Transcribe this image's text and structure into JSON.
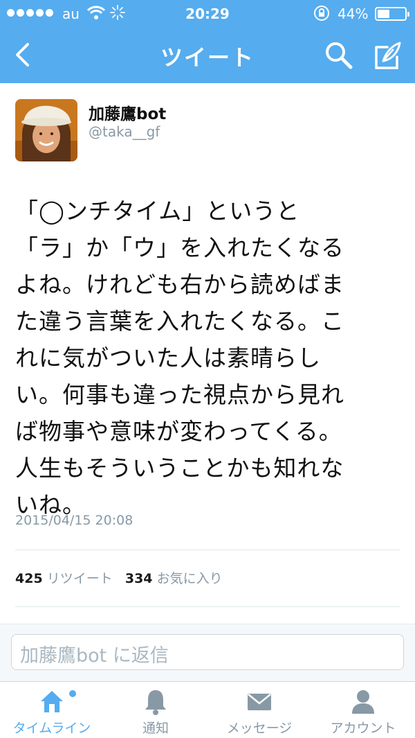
{
  "status_bar": {
    "carrier": "au",
    "time": "20:29",
    "battery": "44%",
    "battery_level": 0.44
  },
  "nav": {
    "title": "ツイート"
  },
  "tweet": {
    "display_name": "加藤鷹bot",
    "handle": "@taka__gf",
    "lines": [
      "「◯ンチタイム」というと",
      "「ラ」か「ウ」を入れたくなる",
      "よね。けれども右から読めばま",
      "た違う言葉を入れたくなる。こ",
      "れに気がついた人は素晴らし",
      "い。何事も違った視点から見れ",
      "ば物事や意味が変わってくる。",
      "人生もそういうことかも知れな",
      "いね。"
    ],
    "date": "2015/04/15 20:08",
    "retweet_count": "425",
    "retweet_label": "リツイート",
    "favorite_count": "334",
    "favorite_label": "お気に入り"
  },
  "reply": {
    "placeholder": "加藤鷹bot に返信"
  },
  "tabs": [
    {
      "label": "タイムライン",
      "icon": "home-icon"
    },
    {
      "label": "通知",
      "icon": "bell-icon"
    },
    {
      "label": "メッセージ",
      "icon": "envelope-icon"
    },
    {
      "label": "アカウント",
      "icon": "person-icon"
    }
  ],
  "colors": {
    "accent": "#55acee",
    "muted": "#8899a6"
  }
}
